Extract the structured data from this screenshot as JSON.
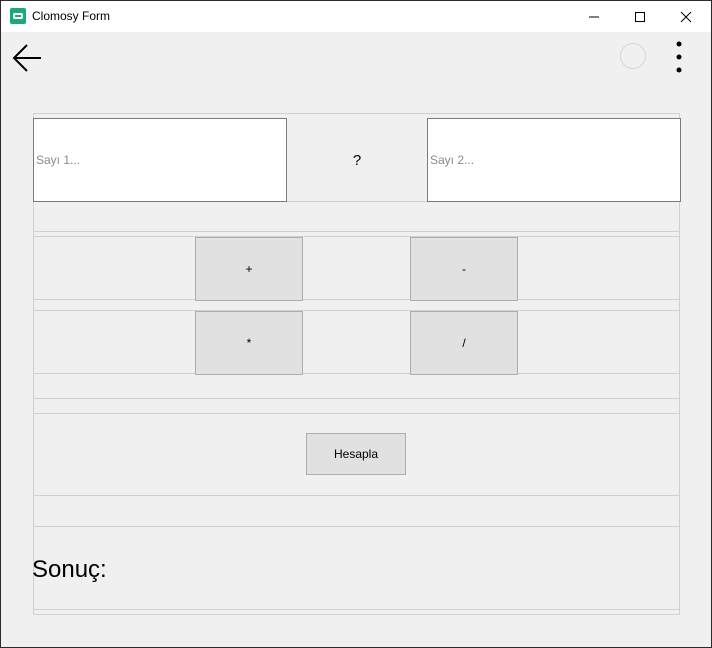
{
  "window": {
    "title": "Clomosy Form",
    "icon": "clomosy-app-icon",
    "controls": [
      "minimize-icon",
      "maximize-icon",
      "close-icon"
    ]
  },
  "appbar": {
    "back_icon": "back-arrow-icon",
    "loading_icon": "spinner-icon",
    "menu_icon": "more-vert-icon"
  },
  "form": {
    "input1": {
      "placeholder": "Sayı 1...",
      "value": ""
    },
    "operator": "?",
    "input2": {
      "placeholder": "Sayı 2...",
      "value": ""
    },
    "buttons": {
      "plus": "+",
      "minus": "-",
      "multiply": "*",
      "divide": "/"
    },
    "calculate": "Hesapla",
    "result_label": "Sonuç:"
  },
  "colors": {
    "background": "#f0f0f0",
    "button_face": "#e1e1e1",
    "button_border": "#adadad",
    "app_icon": "#19a97b"
  }
}
